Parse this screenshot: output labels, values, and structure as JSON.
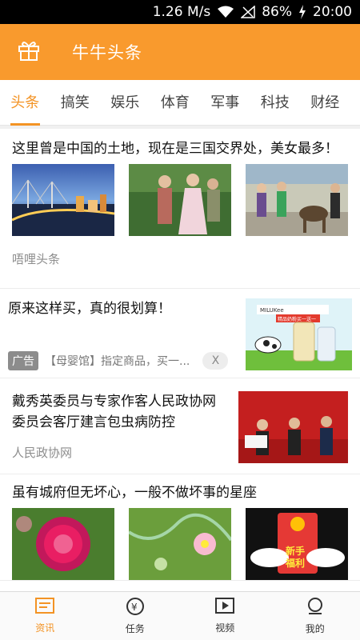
{
  "status_bar": {
    "speed": "1.26 M/s",
    "battery": "86%",
    "time": "20:00"
  },
  "header": {
    "title": "牛牛头条",
    "gift_icon": "gift-icon"
  },
  "tabs": [
    {
      "label": "头条",
      "active": true
    },
    {
      "label": "搞笑"
    },
    {
      "label": "娱乐"
    },
    {
      "label": "体育"
    },
    {
      "label": "军事"
    },
    {
      "label": "科技"
    },
    {
      "label": "财经"
    }
  ],
  "feed": [
    {
      "title": "这里曾是中国的土地，现在是三国交界处，美女最多！",
      "source": "唔哩头条"
    },
    {
      "title": "原来这样买，真的很划算！",
      "ad_tag": "广告",
      "ad_desc": "【母婴馆】指定商品，买一...",
      "close": "X",
      "image_text": {
        "line1": "MILUKee",
        "line2": "精品奶粉买一送一"
      }
    },
    {
      "title": "戴秀英委员与专家作客人民政协网委员会客厅建言包虫病防控",
      "source": "人民政协网"
    },
    {
      "title": "虽有城府但无坏心，一般不做坏事的星座",
      "image_badge": "新手\n福利"
    }
  ],
  "bottom_nav": [
    {
      "label": "资讯",
      "icon": "news-icon",
      "active": true
    },
    {
      "label": "任务",
      "icon": "coin-icon"
    },
    {
      "label": "视频",
      "icon": "video-icon"
    },
    {
      "label": "我的",
      "icon": "profile-icon"
    }
  ],
  "colors": {
    "accent": "#f99a2d",
    "tab_active": "#f39324",
    "status_bg": "#000000"
  }
}
